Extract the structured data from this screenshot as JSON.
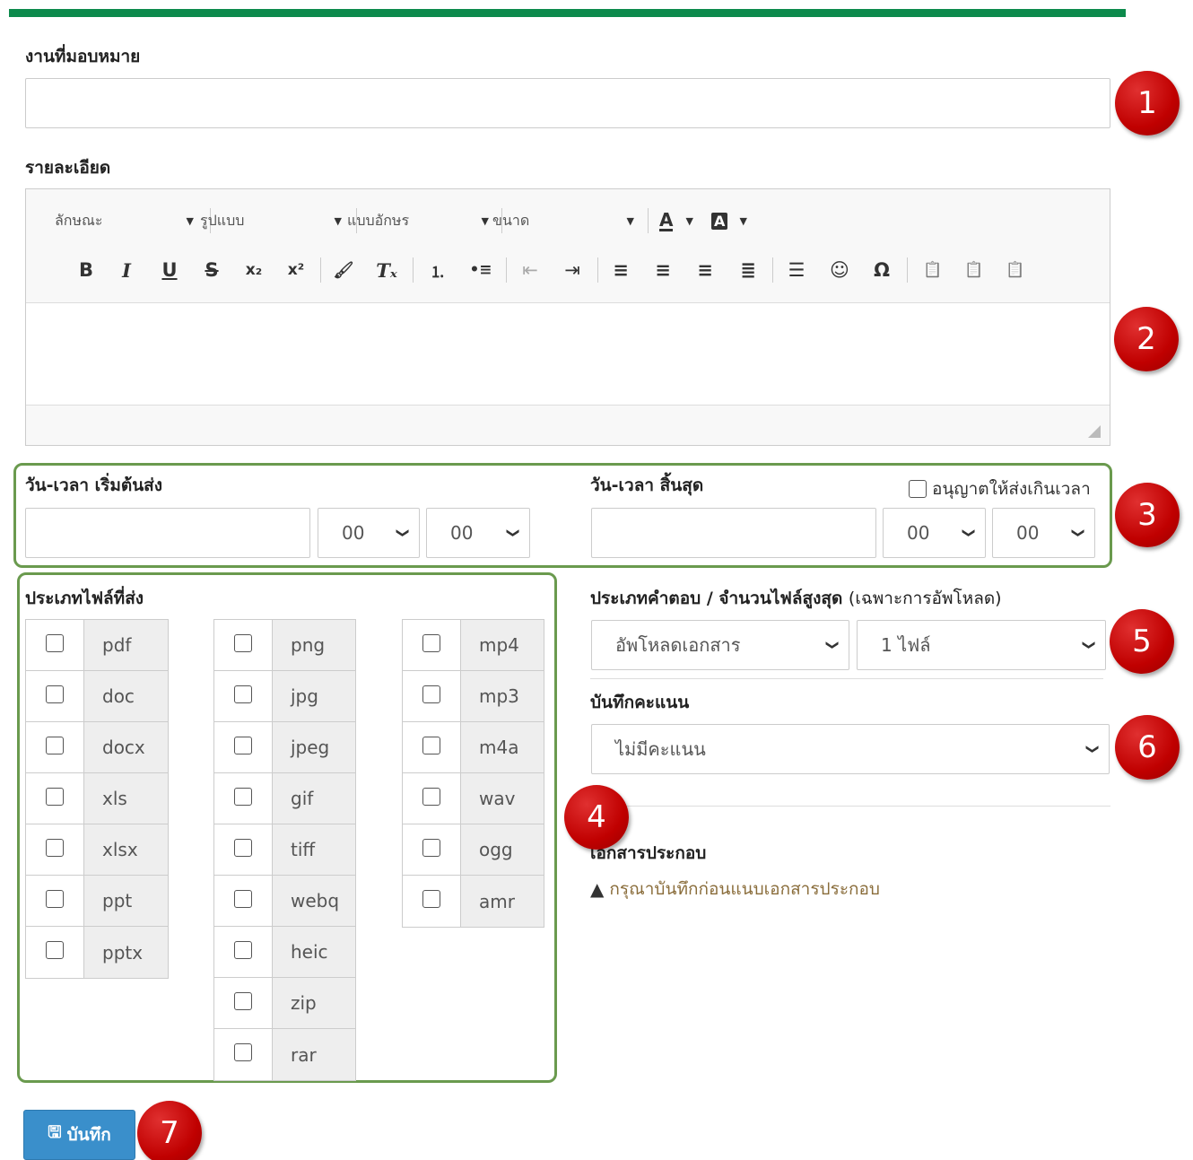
{
  "assignment_label": "งานที่มอบหมาย",
  "assignment_value": "",
  "detail_label": "รายละเอียด",
  "editor": {
    "combos": [
      "ลักษณะ",
      "รูปแบบ",
      "แบบอักษร",
      "ขนาด"
    ],
    "text_color_icon": "A",
    "bg_color_icon": "A",
    "buttons": [
      {
        "name": "bold-icon",
        "glyph": "B"
      },
      {
        "name": "italic-icon",
        "glyph": "I"
      },
      {
        "name": "underline-icon",
        "glyph": "U"
      },
      {
        "name": "strikethrough-icon",
        "glyph": "S"
      },
      {
        "name": "subscript-icon",
        "glyph": "x₂"
      },
      {
        "name": "superscript-icon",
        "glyph": "x²"
      },
      {
        "name": "copy-format-icon",
        "glyph": "🖌"
      },
      {
        "name": "remove-format-icon",
        "glyph": "Tₓ"
      },
      {
        "name": "numbered-list-icon",
        "glyph": "⒈"
      },
      {
        "name": "bulleted-list-icon",
        "glyph": "•≡"
      },
      {
        "name": "outdent-icon",
        "glyph": "⇤"
      },
      {
        "name": "indent-icon",
        "glyph": "⇥"
      },
      {
        "name": "align-left-icon",
        "glyph": "≡"
      },
      {
        "name": "align-center-icon",
        "glyph": "≡"
      },
      {
        "name": "align-right-icon",
        "glyph": "≡"
      },
      {
        "name": "justify-icon",
        "glyph": "≣"
      },
      {
        "name": "horizontal-line-icon",
        "glyph": "☰"
      },
      {
        "name": "smiley-icon",
        "glyph": "☺"
      },
      {
        "name": "special-char-icon",
        "glyph": "Ω"
      },
      {
        "name": "paste-icon",
        "glyph": "📋"
      },
      {
        "name": "paste-text-icon",
        "glyph": "📋"
      },
      {
        "name": "paste-word-icon",
        "glyph": "📋"
      }
    ]
  },
  "start_label": "วัน-เวลา เริ่มต้นส่ง",
  "end_label": "วัน-เวลา สิ้นสุด",
  "allow_late_label": "อนุญาตให้ส่งเกินเวลา",
  "start_hour": "00",
  "start_minute": "00",
  "end_hour": "00",
  "end_minute": "00",
  "file_types_label": "ประเภทไฟล์ที่ส่ง",
  "file_types": {
    "documents": [
      "pdf",
      "doc",
      "docx",
      "xls",
      "xlsx",
      "ppt",
      "pptx"
    ],
    "images": [
      "png",
      "jpg",
      "jpeg",
      "gif",
      "tiff",
      "webq",
      "heic",
      "zip",
      "rar"
    ],
    "media": [
      "mp4",
      "mp3",
      "m4a",
      "wav",
      "ogg",
      "amr"
    ]
  },
  "answer_type_label": "ประเภทคำตอบ / จำนวนไฟล์สูงสุด",
  "answer_type_note": "(เฉพาะการอัพโหลด)",
  "answer_type_value": "อัพโหลดเอกสาร",
  "max_files_value": "1 ไฟล์",
  "score_label": "บันทึกคะแนน",
  "score_value": "ไม่มีคะแนน",
  "attachments_label": "เอกสารประกอบ",
  "attachments_warning": "กรุณาบันทึกก่อนแนบเอกสารประกอบ",
  "save_label": "บันทึก",
  "badges": [
    "1",
    "2",
    "3",
    "4",
    "5",
    "6",
    "7"
  ]
}
